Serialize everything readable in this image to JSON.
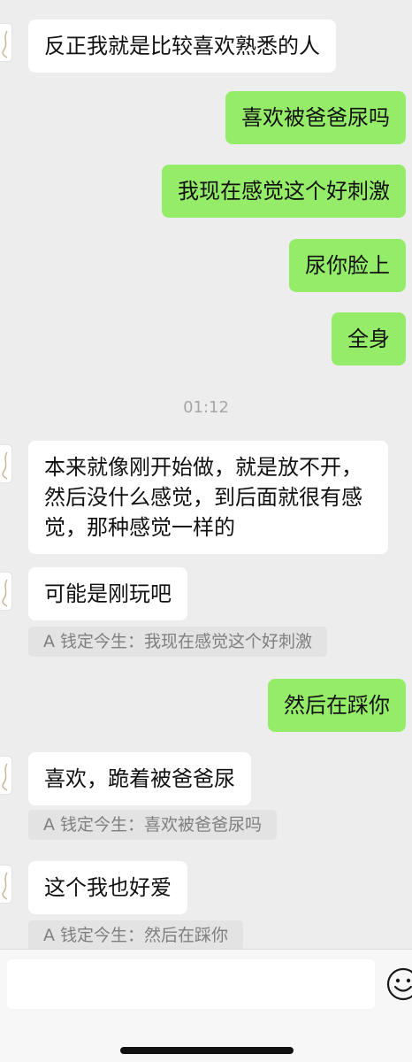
{
  "chat": {
    "timestamp": "01:12",
    "messages": [
      {
        "text": "反正我就是比较喜欢熟悉的人"
      },
      {
        "text": "喜欢被爸爸尿吗"
      },
      {
        "text": "我现在感觉这个好刺激"
      },
      {
        "text": "尿你脸上"
      },
      {
        "text": "全身"
      },
      {
        "text": "本来就像刚开始做，就是放不开，然后没什么感觉，到后面就很有感觉，那种感觉一样的"
      },
      {
        "text": "可能是刚玩吧",
        "quote": "A 钱定今生：我现在感觉这个好刺激"
      },
      {
        "text": "然后在踩你"
      },
      {
        "text": "喜欢，跪着被爸爸尿",
        "quote": "A 钱定今生：喜欢被爸爸尿吗"
      },
      {
        "text": "这个我也好爱",
        "quote": "A 钱定今生：然后在踩你"
      }
    ]
  },
  "input_bar": {
    "value": "",
    "emoji_icon": "smiley-face-icon"
  },
  "colors": {
    "background": "#ededed",
    "incoming_bubble": "#ffffff",
    "outgoing_bubble": "#95ec69",
    "quote_background": "#e3e3e3"
  }
}
